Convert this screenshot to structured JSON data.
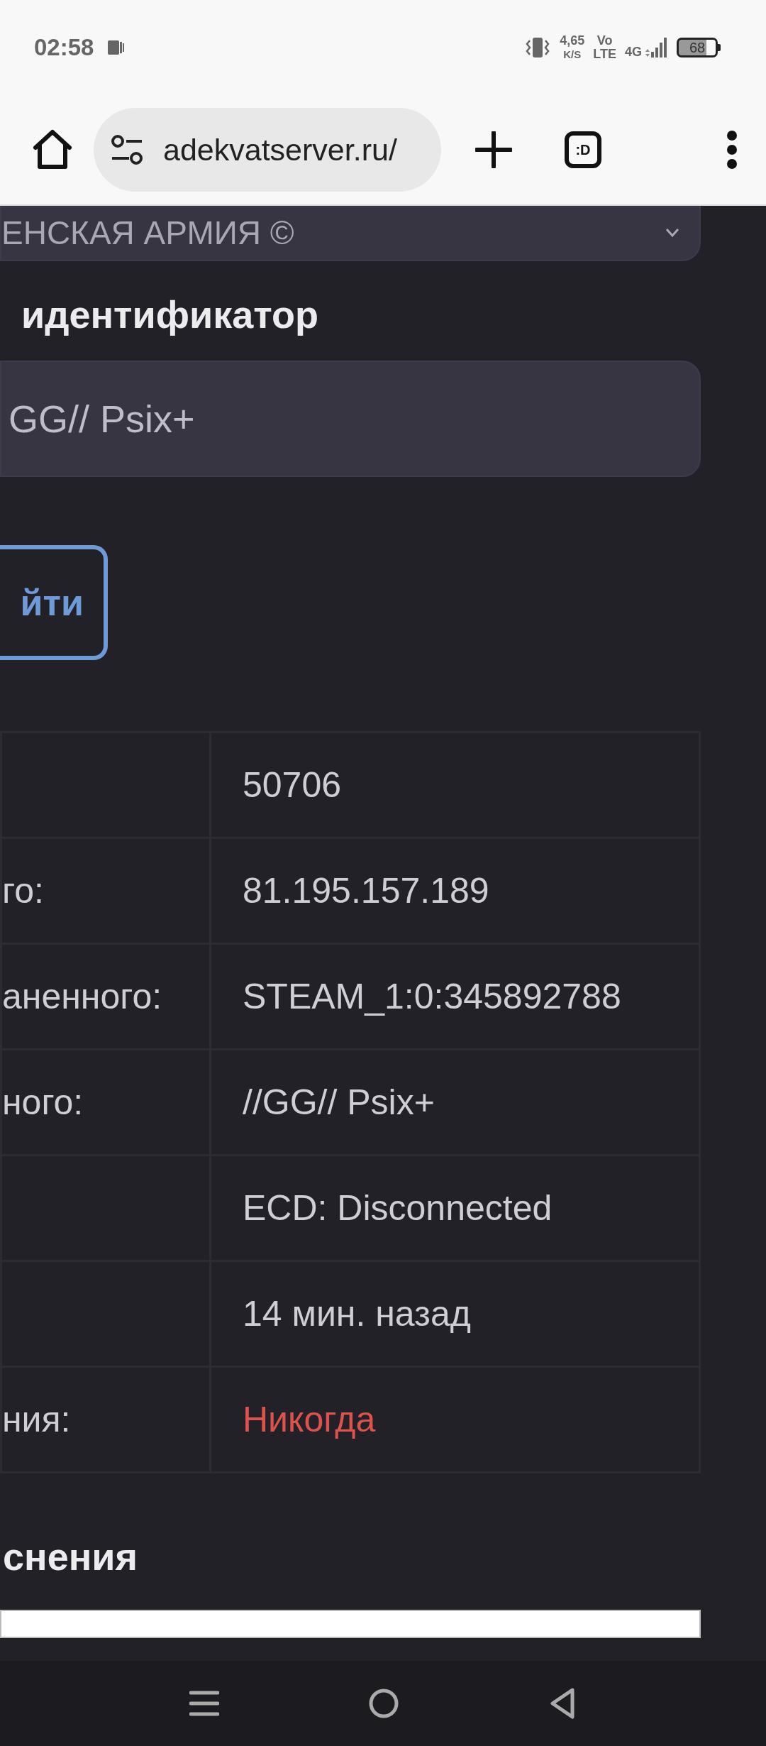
{
  "status_bar": {
    "time": "02:58",
    "net_speed": "4,65",
    "net_unit": "K/S",
    "volte_top": "Vo",
    "volte_bottom": "LTE",
    "network": "4G",
    "battery": "68"
  },
  "browser": {
    "url": "adekvatserver.ru/",
    "tab_switcher": ":D"
  },
  "page": {
    "dropdown_value": "ЕНСКАЯ АРМИЯ ©",
    "id_label": "идентификатор",
    "id_value": "GG// Psix+",
    "button": "йти",
    "rows": [
      {
        "value": "50706",
        "kind": "plain"
      },
      {
        "label": "го:",
        "value": "81.195.157.189",
        "kind": "plain"
      },
      {
        "label": "аненного:",
        "value": "STEAM_1:0:345892788",
        "kind": "plain"
      },
      {
        "label": "ного:",
        "value": "//GG// Psix+",
        "kind": "plain"
      },
      {
        "value": "ECD: Disconnected",
        "kind": "plain"
      },
      {
        "value": "14 мин. назад",
        "kind": "plain"
      },
      {
        "label": "ния:",
        "value": "Никогда",
        "kind": "alert"
      }
    ],
    "section_heading": "снения"
  }
}
